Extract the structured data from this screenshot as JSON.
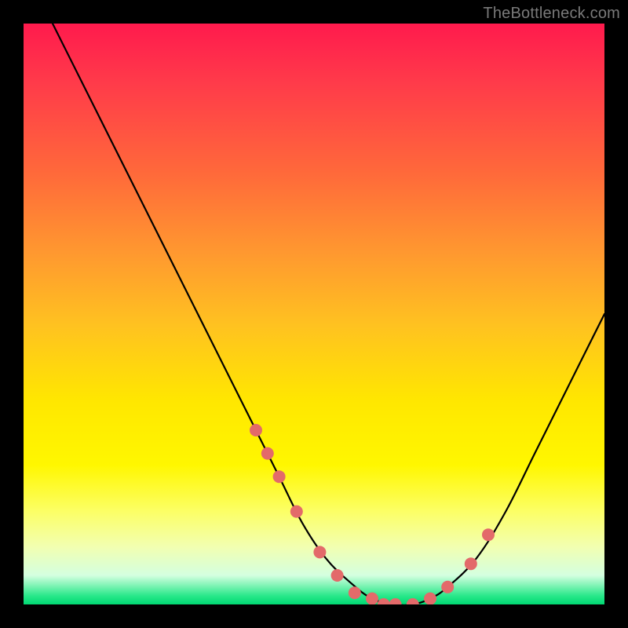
{
  "watermark": "TheBottleneck.com",
  "chart_data": {
    "type": "line",
    "title": "",
    "xlabel": "",
    "ylabel": "",
    "xlim": [
      0,
      100
    ],
    "ylim": [
      0,
      100
    ],
    "grid": false,
    "legend": false,
    "series": [
      {
        "name": "bottleneck-curve",
        "x": [
          5,
          10,
          15,
          20,
          25,
          30,
          35,
          40,
          44,
          48,
          52,
          56,
          60,
          64,
          67,
          70,
          73,
          78,
          83,
          88,
          93,
          100
        ],
        "y": [
          100,
          90,
          80,
          70,
          60,
          50,
          40,
          30,
          22,
          14,
          8,
          4,
          1,
          0,
          0,
          1,
          3,
          8,
          16,
          26,
          36,
          50
        ]
      }
    ],
    "markers": {
      "name": "highlight-points",
      "color": "#e86a6a",
      "x": [
        40,
        42,
        44,
        47,
        51,
        54,
        57,
        60,
        62,
        64,
        67,
        70,
        73,
        77,
        80
      ],
      "y": [
        30,
        26,
        22,
        16,
        9,
        5,
        2,
        1,
        0,
        0,
        0,
        1,
        3,
        7,
        12
      ]
    }
  },
  "colors": {
    "curve_stroke": "#000000",
    "marker_fill": "#e36a6a",
    "marker_stroke": "#d65a5a"
  }
}
